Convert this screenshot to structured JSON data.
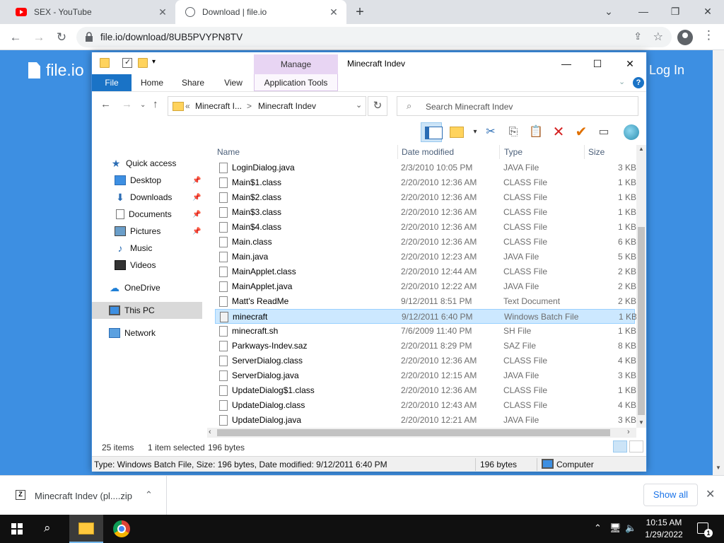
{
  "browser": {
    "tabs": [
      {
        "title": "SEX - YouTube",
        "icon": "youtube-icon"
      },
      {
        "title": "Download | file.io",
        "icon": "globe-icon"
      }
    ],
    "url": "file.io/download/8UB5PVYPN8TV"
  },
  "webpage": {
    "logo_text": "file.io",
    "login_label": "Log In",
    "background_color": "#3d8fe2"
  },
  "explorer": {
    "title": "Minecraft Indev",
    "context_group": "Manage",
    "ribbon_tabs": {
      "file": "File",
      "home": "Home",
      "share": "Share",
      "view": "View",
      "app_tools": "Application Tools"
    },
    "breadcrumb": {
      "prefix": "«",
      "parent": "Minecraft I...",
      "separator": ">",
      "current": "Minecraft Indev"
    },
    "search_placeholder": "Search Minecraft Indev",
    "nav": {
      "quick_access": "Quick access",
      "desktop": "Desktop",
      "downloads": "Downloads",
      "documents": "Documents",
      "pictures": "Pictures",
      "music": "Music",
      "videos": "Videos",
      "onedrive": "OneDrive",
      "this_pc": "This PC",
      "network": "Network"
    },
    "columns": {
      "name": "Name",
      "date": "Date modified",
      "type": "Type",
      "size": "Size"
    },
    "files": [
      {
        "name": "LoginDialog.java",
        "date": "2/3/2010 10:05 PM",
        "type": "JAVA File",
        "size": "3 KB"
      },
      {
        "name": "Main$1.class",
        "date": "2/20/2010 12:36 AM",
        "type": "CLASS File",
        "size": "1 KB"
      },
      {
        "name": "Main$2.class",
        "date": "2/20/2010 12:36 AM",
        "type": "CLASS File",
        "size": "1 KB"
      },
      {
        "name": "Main$3.class",
        "date": "2/20/2010 12:36 AM",
        "type": "CLASS File",
        "size": "1 KB"
      },
      {
        "name": "Main$4.class",
        "date": "2/20/2010 12:36 AM",
        "type": "CLASS File",
        "size": "1 KB"
      },
      {
        "name": "Main.class",
        "date": "2/20/2010 12:36 AM",
        "type": "CLASS File",
        "size": "6 KB"
      },
      {
        "name": "Main.java",
        "date": "2/20/2010 12:23 AM",
        "type": "JAVA File",
        "size": "5 KB"
      },
      {
        "name": "MainApplet.class",
        "date": "2/20/2010 12:44 AM",
        "type": "CLASS File",
        "size": "2 KB"
      },
      {
        "name": "MainApplet.java",
        "date": "2/20/2010 12:22 AM",
        "type": "JAVA File",
        "size": "2 KB"
      },
      {
        "name": "Matt's ReadMe",
        "date": "9/12/2011 8:51 PM",
        "type": "Text Document",
        "size": "2 KB"
      },
      {
        "name": "minecraft",
        "date": "9/12/2011 6:40 PM",
        "type": "Windows Batch File",
        "size": "1 KB",
        "selected": true
      },
      {
        "name": "minecraft.sh",
        "date": "7/6/2009 11:40 PM",
        "type": "SH File",
        "size": "1 KB"
      },
      {
        "name": "Parkways-Indev.saz",
        "date": "2/20/2011 8:29 PM",
        "type": "SAZ File",
        "size": "8 KB"
      },
      {
        "name": "ServerDialog.class",
        "date": "2/20/2010 12:36 AM",
        "type": "CLASS File",
        "size": "4 KB"
      },
      {
        "name": "ServerDialog.java",
        "date": "2/20/2010 12:15 AM",
        "type": "JAVA File",
        "size": "3 KB"
      },
      {
        "name": "UpdateDialog$1.class",
        "date": "2/20/2010 12:36 AM",
        "type": "CLASS File",
        "size": "1 KB"
      },
      {
        "name": "UpdateDialog.class",
        "date": "2/20/2010 12:43 AM",
        "type": "CLASS File",
        "size": "4 KB"
      },
      {
        "name": "UpdateDialog.java",
        "date": "2/20/2010 12:21 AM",
        "type": "JAVA File",
        "size": "3 KB"
      }
    ],
    "status": {
      "items": "25 items",
      "selected": "1 item selected",
      "size": "196 bytes"
    },
    "details_bar": {
      "info": "Type: Windows Batch File, Size: 196 bytes, Date modified: 9/12/2011 6:40 PM",
      "size": "196 bytes",
      "location": "Computer"
    }
  },
  "download_shelf": {
    "file_name": "Minecraft Indev (pl....zip",
    "show_all_label": "Show all"
  },
  "taskbar": {
    "time": "10:15 AM",
    "date": "1/29/2022",
    "notification_count": "1"
  }
}
